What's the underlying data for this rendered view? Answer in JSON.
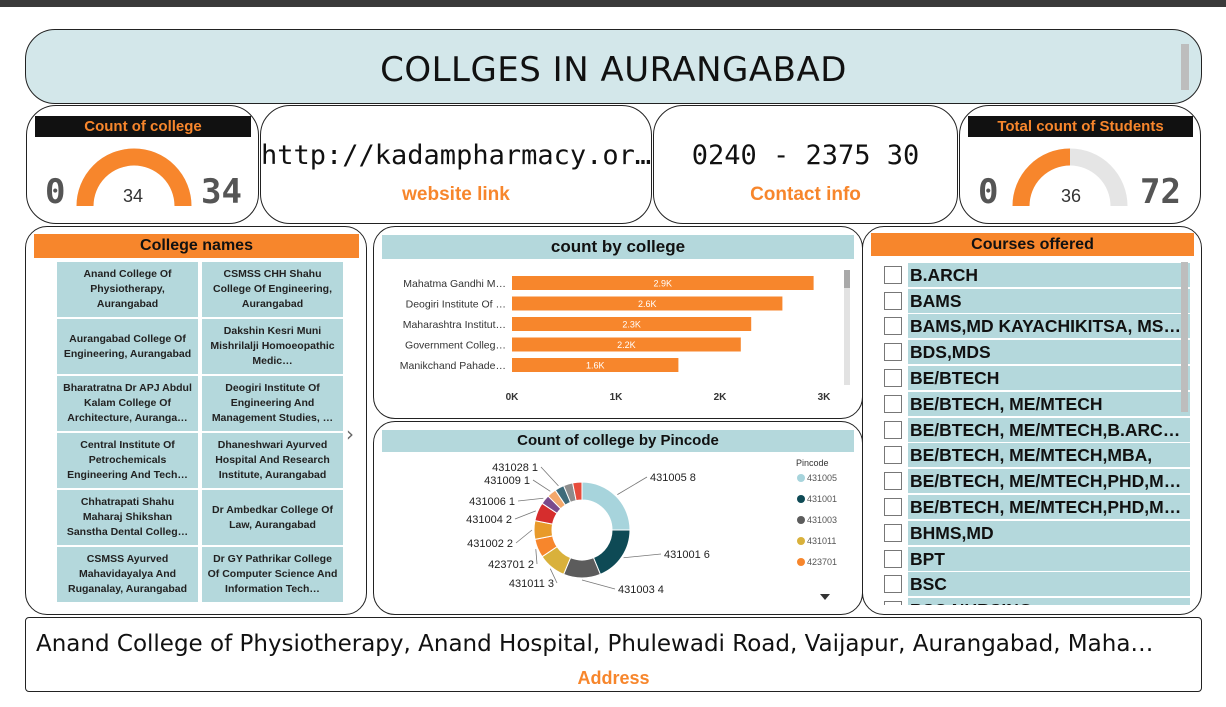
{
  "title": "COLLGES IN AURANGABAD",
  "colors": {
    "accent": "#f7862c",
    "teal": "#b4d8dc",
    "title_bg": "#d3e7ea",
    "gauge_empty": "#e5e5e5"
  },
  "kpi_college": {
    "header": "Count of college",
    "min": "0",
    "max": "34",
    "value": "34",
    "min_value": 0,
    "max_value": 34,
    "current": 34
  },
  "kpi_website": {
    "value": "http://kadampharmacy.or…",
    "label": "website link"
  },
  "kpi_contact": {
    "value": "0240 - 2375 30",
    "label": "Contact info"
  },
  "kpi_students": {
    "header": "Total count of Students",
    "min": "0",
    "max": "72",
    "value": "36",
    "min_value": 0,
    "max_value": 72,
    "current": 36
  },
  "college_names": {
    "header": "College names",
    "items": [
      "Anand College Of Physiotherapy, Aurangabad",
      "CSMSS CHH Shahu College Of Engineering, Aurangabad",
      "Aurangabad College Of Engineering, Aurangabad",
      "Dakshin Kesri Muni Mishrilalji Homoeopathic Medic…",
      "Bharatratna Dr APJ Abdul Kalam College Of Architecture, Auranga…",
      "Deogiri Institute Of Engineering And Management Studies, …",
      "Central Institute Of Petrochemicals Engineering And Tech…",
      "Dhaneshwari Ayurved Hospital And Research Institute, Aurangabad",
      "Chhatrapati Shahu Maharaj Shikshan Sanstha Dental Colleg…",
      "Dr Ambedkar College Of Law, Aurangabad",
      "CSMSS Ayurved Mahavidayalya And Ruganalay, Aurangabad",
      "Dr GY Pathrikar College Of Computer Science And Information Tech…"
    ],
    "next_icon": "chevron-right-icon"
  },
  "chart_data": [
    {
      "type": "bar",
      "title": "count by college",
      "orientation": "horizontal",
      "categories": [
        "Mahatma Gandhi M…",
        "Deogiri Institute Of …",
        "Maharashtra Institut…",
        "Government Colleg…",
        "Manikchand Pahade…"
      ],
      "values": [
        2900,
        2600,
        2300,
        2200,
        1600
      ],
      "data_labels": [
        "2.9K",
        "2.6K",
        "2.3K",
        "2.2K",
        "1.6K"
      ],
      "x_ticks": [
        "0K",
        "1K",
        "2K",
        "3K"
      ],
      "xlim": [
        0,
        3000
      ],
      "color": "#f7862c"
    },
    {
      "type": "pie",
      "title": "Count of college by Pincode",
      "legend_title": "Pincode",
      "legend_position": "right",
      "slices": [
        {
          "label": "431005",
          "value": 8,
          "color": "#a7d4dc"
        },
        {
          "label": "431001",
          "value": 6,
          "color": "#0e4a55"
        },
        {
          "label": "431003",
          "value": 4,
          "color": "#5c5c5c"
        },
        {
          "label": "431011",
          "value": 3,
          "color": "#d9b13b"
        },
        {
          "label": "423701",
          "value": 2,
          "color": "#f7862c"
        },
        {
          "label": "431002",
          "value": 2,
          "color": "#e89a2a"
        },
        {
          "label": "431004",
          "value": 2,
          "color": "#d62d2d"
        },
        {
          "label": "431006",
          "value": 1,
          "color": "#7a4b8c"
        },
        {
          "label": "431009",
          "value": 1,
          "color": "#f4a86b"
        },
        {
          "label": "431028",
          "value": 1,
          "color": "#3e6b7a"
        },
        {
          "label": "",
          "value": 1,
          "color": "#8c8c8c"
        },
        {
          "label": "",
          "value": 1,
          "color": "#e74c3c"
        }
      ],
      "data_labels": [
        "431005 8",
        "431001 6",
        "431003 4",
        "431011 3",
        "423701 2",
        "431002 2",
        "431004 2",
        "431006 1",
        "431009 1",
        "431028 1"
      ],
      "legend": [
        "431005",
        "431001",
        "431003",
        "431011",
        "423701"
      ]
    }
  ],
  "courses": {
    "header": "Courses offered",
    "items": [
      "B.ARCH",
      "BAMS",
      "BAMS,MD KAYACHIKITSA, MS…",
      "BDS,MDS",
      "BE/BTECH",
      "BE/BTECH, ME/MTECH",
      "BE/BTECH, ME/MTECH,B.ARC…",
      "BE/BTECH, ME/MTECH,MBA,",
      "BE/BTECH, ME/MTECH,PHD,M…",
      "BE/BTECH, ME/MTECH,PHD,M…",
      "BHMS,MD",
      "BPT",
      "BSC",
      "BSC NURSING"
    ]
  },
  "address": {
    "value": "Anand College of Physiotherapy, Anand Hospital, Phulewadi Road, Vaijapur, Aurangabad, Maha…",
    "label": "Address"
  }
}
